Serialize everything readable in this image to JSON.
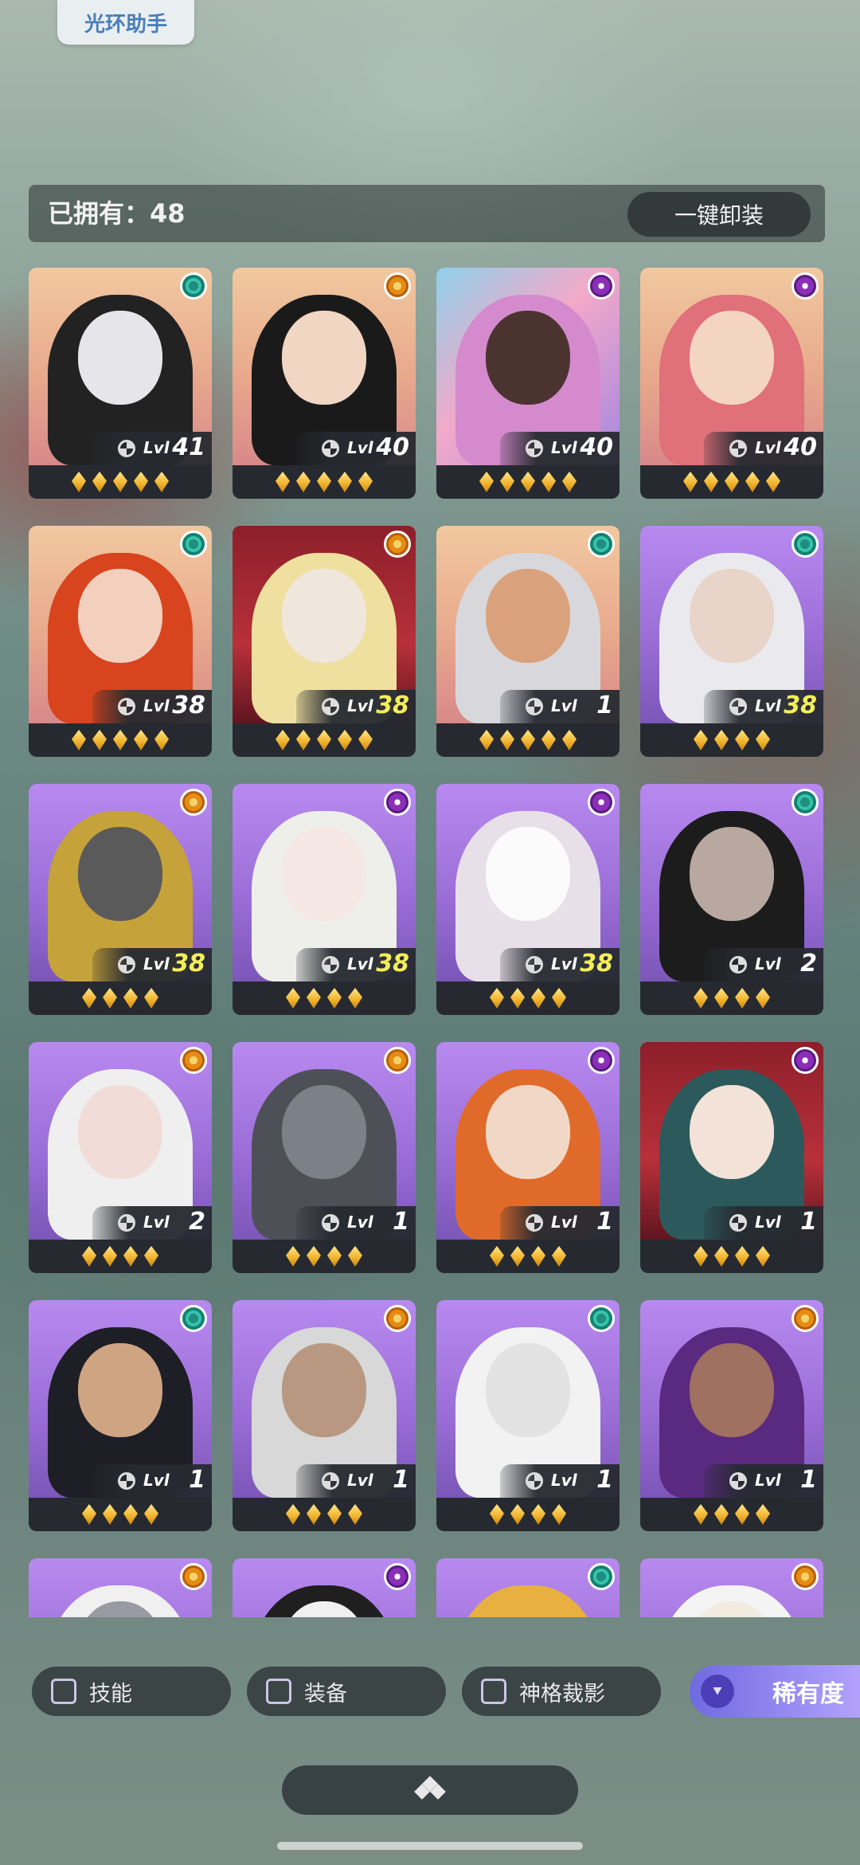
{
  "header": {
    "helper_label": "光环助手"
  },
  "owned": {
    "label": "已拥有：48",
    "unequip_label": "一键卸装"
  },
  "cards": [
    {
      "bg": "orange",
      "skin": "#e6e6ea",
      "hair": "#222",
      "faction": "teal",
      "level": "41",
      "gold": false,
      "stars": 5
    },
    {
      "bg": "orange",
      "skin": "#f1d6c4",
      "hair": "#1a1a1a",
      "faction": "orange",
      "level": "40",
      "gold": false,
      "stars": 5
    },
    {
      "bg": "mixed",
      "skin": "#4b3430",
      "hair": "#d58acd",
      "faction": "purple",
      "level": "40",
      "gold": false,
      "stars": 5
    },
    {
      "bg": "orange",
      "skin": "#f4d4c2",
      "hair": "#e0707a",
      "faction": "purple",
      "level": "40",
      "gold": false,
      "stars": 5
    },
    {
      "bg": "orange",
      "skin": "#f2d0bd",
      "hair": "#d8441e",
      "faction": "teal",
      "level": "38",
      "gold": false,
      "stars": 5
    },
    {
      "bg": "red",
      "skin": "#efe6dc",
      "hair": "#f0e0a0",
      "faction": "orange",
      "level": "38",
      "gold": true,
      "stars": 5
    },
    {
      "bg": "orange",
      "skin": "#d9a27c",
      "hair": "#d8d8dc",
      "faction": "teal",
      "level": "1",
      "gold": false,
      "stars": 5
    },
    {
      "bg": "purple",
      "skin": "#e8d4c8",
      "hair": "#eaeaee",
      "faction": "teal",
      "level": "38",
      "gold": true,
      "stars": 4
    },
    {
      "bg": "purple",
      "skin": "#5a5a5a",
      "hair": "#c6a23a",
      "faction": "orange",
      "level": "38",
      "gold": true,
      "stars": 4
    },
    {
      "bg": "purple",
      "skin": "#f5e8e4",
      "hair": "#eeeeea",
      "faction": "purple",
      "level": "38",
      "gold": true,
      "stars": 4
    },
    {
      "bg": "purple",
      "skin": "#fbfbfb",
      "hair": "#e8e0e8",
      "faction": "purple",
      "level": "38",
      "gold": true,
      "stars": 4
    },
    {
      "bg": "purple",
      "skin": "#b8a8a0",
      "hair": "#1c1c1c",
      "faction": "teal",
      "level": "2",
      "gold": false,
      "stars": 4
    },
    {
      "bg": "purple",
      "skin": "#f1dcd8",
      "hair": "#efefef",
      "faction": "orange",
      "level": "2",
      "gold": false,
      "stars": 4
    },
    {
      "bg": "purple",
      "skin": "#7c8088",
      "hair": "#4e5058",
      "faction": "orange",
      "level": "1",
      "gold": false,
      "stars": 4
    },
    {
      "bg": "purple",
      "skin": "#f1d8c6",
      "hair": "#e06a2a",
      "faction": "purple",
      "level": "1",
      "gold": false,
      "stars": 4
    },
    {
      "bg": "red",
      "skin": "#f3e2d8",
      "hair": "#2c5a5c",
      "faction": "purple",
      "level": "1",
      "gold": false,
      "stars": 4
    },
    {
      "bg": "purple",
      "skin": "#cfa482",
      "hair": "#1e1e26",
      "faction": "teal",
      "level": "1",
      "gold": false,
      "stars": 4
    },
    {
      "bg": "purple",
      "skin": "#b89880",
      "hair": "#d8d8d8",
      "faction": "orange",
      "level": "1",
      "gold": false,
      "stars": 4
    },
    {
      "bg": "purple",
      "skin": "#e2e2e2",
      "hair": "#f2f2f2",
      "faction": "teal",
      "level": "1",
      "gold": false,
      "stars": 4
    },
    {
      "bg": "purple",
      "skin": "#a07060",
      "hair": "#5a2a80",
      "faction": "orange",
      "level": "1",
      "gold": false,
      "stars": 4
    },
    {
      "bg": "purple",
      "skin": "#9a9aa2",
      "hair": "#f0f0f0",
      "faction": "orange",
      "level": "",
      "gold": false,
      "stars": 0
    },
    {
      "bg": "purple",
      "skin": "#f0f0f0",
      "hair": "#1f1f1f",
      "faction": "purple",
      "level": "",
      "gold": false,
      "stars": 0
    },
    {
      "bg": "purple",
      "skin": "#e8b040",
      "hair": "#e8b040",
      "faction": "teal",
      "level": "",
      "gold": false,
      "stars": 0
    },
    {
      "bg": "purple",
      "skin": "#f2ece0",
      "hair": "#f4f4f4",
      "faction": "orange",
      "level": "",
      "gold": false,
      "stars": 0
    }
  ],
  "card_level_prefix": "Lvl",
  "filters": [
    {
      "label": "技能"
    },
    {
      "label": "装备"
    },
    {
      "label": "神格裁影"
    }
  ],
  "rarity": {
    "label": "稀有度",
    "icon": "double-chevron-down-icon"
  },
  "bottom": {
    "icon": "diamond-cluster-icon"
  }
}
